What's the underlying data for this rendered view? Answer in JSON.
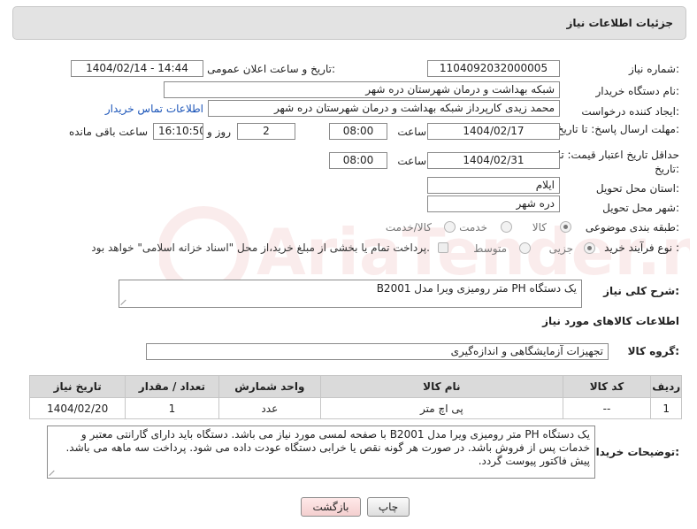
{
  "panel": {
    "title": "جزئیات اطلاعات نیاز"
  },
  "form": {
    "need_number_label": "شماره نیاز:",
    "need_number": "1104092032000005",
    "announce_label": "تاریخ و ساعت اعلان عمومی:",
    "announce_value": "1404/02/14 - 14:44",
    "buyer_org_label": "نام دستگاه خریدار:",
    "buyer_org": "شبکه بهداشت و درمان شهرستان دره شهر",
    "creator_label": "ایجاد کننده درخواست:",
    "creator": "محمد زیدی کارپرداز شبکه بهداشت و درمان شهرستان دره شهر",
    "contact_link": "اطلاعات تماس خریدار",
    "reply_deadline_label": "مهلت ارسال پاسخ: تا تاریخ:",
    "reply_date": "1404/02/17",
    "time_label": "ساعت",
    "reply_time": "08:00",
    "days_value": "2",
    "days_label": "روز و",
    "remaining_time": "16:10:50",
    "remaining_label": "ساعت باقی مانده",
    "validity_label": "حداقل تاریخ اعتبار قیمت: تا تاریخ:",
    "validity_date": "1404/02/31",
    "validity_time": "08:00",
    "province_label": "استان محل تحویل:",
    "province": "ایلام",
    "city_label": "شهر محل تحویل:",
    "city": "دره شهر",
    "category_label": "طبقه بندی موضوعی:",
    "category_options": [
      "کالا",
      "خدمت",
      "کالا/خدمت"
    ],
    "purchase_type_label": "نوع فرآیند خرید :",
    "purchase_options": [
      "جزیی",
      "متوسط"
    ],
    "payment_note": "پرداخت تمام یا بخشی از مبلغ خرید،از محل \"اسناد خزانه اسلامی\" خواهد بود."
  },
  "description": {
    "label": "شرح کلی نیاز:",
    "value": "یک دستگاه PH متر رومیزی ویرا مدل B2001"
  },
  "goods_info": {
    "heading": "اطلاعات کالاهای مورد نیاز",
    "group_label": "گروه کالا:",
    "group_value": "تجهیزات آزمایشگاهی و اندازه‌گیری"
  },
  "table": {
    "headers": [
      "ردیف",
      "کد کالا",
      "نام کالا",
      "واحد شمارش",
      "تعداد / مقدار",
      "تاریخ نیاز"
    ],
    "rows": [
      [
        "1",
        "--",
        "پی اچ متر",
        "عدد",
        "1",
        "1404/02/20"
      ]
    ]
  },
  "buyer_notes": {
    "label": "توضیحات خریدار:",
    "value": "یک دستگاه PH متر رومیزی ویرا مدل B2001 با صفحه لمسی مورد نیاز می باشد. دستگاه باید دارای گارانتی معتبر و خدمات پس از فروش باشد. در صورت هر گونه نقص یا خرابی دستگاه عودت داده می شود. پرداخت سه ماهه می باشد. پیش فاکتور پیوست گردد."
  },
  "buttons": {
    "print": "چاپ",
    "back": "بازگشت"
  },
  "watermark": {
    "text": "AriaTender.net"
  }
}
